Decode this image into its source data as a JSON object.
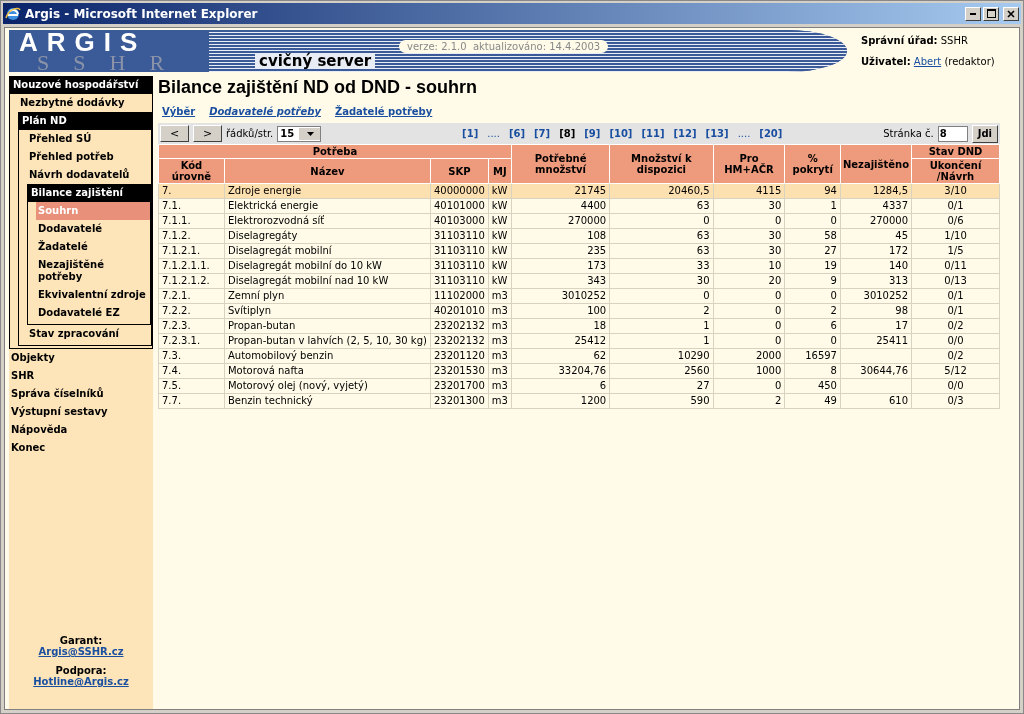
{
  "window": {
    "title": "Argis - Microsoft Internet Explorer"
  },
  "header": {
    "logo": "ARGIS",
    "logo_letters": [
      "S",
      "S",
      "H",
      "R"
    ],
    "server": "cvičný server",
    "version": "verze: 2.1.0  aktualizováno: 14.4.2003",
    "office_label": "Správní úřad:",
    "office": "SSHR",
    "user_label": "Uživatel:",
    "user": "Abert",
    "role": "(redaktor)"
  },
  "sidebar": {
    "items": [
      {
        "label": "Nouzové hospodářství",
        "expanded": true,
        "children": [
          {
            "label": "Nezbytné dodávky"
          },
          {
            "label": "Plán ND",
            "expanded": true,
            "children": [
              {
                "label": "Přehled SÚ"
              },
              {
                "label": "Přehled potřeb"
              },
              {
                "label": "Návrh dodavatelů"
              },
              {
                "label": "Bilance zajištění",
                "expanded": true,
                "children": [
                  {
                    "label": "Souhrn",
                    "selected": true
                  },
                  {
                    "label": "Dodavatelé",
                    "selected": false
                  },
                  {
                    "label": "Žadatelé",
                    "selected": false
                  },
                  {
                    "label": "Nezajištěné potřeby",
                    "selected": false
                  },
                  {
                    "label": "Ekvivalentní zdroje",
                    "selected": false
                  },
                  {
                    "label": "Dodavatelé EZ",
                    "selected": false
                  }
                ]
              },
              {
                "label": "Stav zpracování"
              }
            ]
          }
        ]
      },
      {
        "label": "Objekty"
      },
      {
        "label": "SHR"
      },
      {
        "label": "Správa číselníků"
      },
      {
        "label": "Výstupní sestavy"
      },
      {
        "label": "Nápověda"
      },
      {
        "label": "Konec"
      }
    ],
    "footer": [
      {
        "label": "Garant:",
        "link": "Argis@SSHR.cz"
      },
      {
        "label": "Podpora:",
        "link": "Hotline@Argis.cz"
      }
    ]
  },
  "page": {
    "title": "Bilance zajištění ND od DND - souhrn",
    "links": [
      {
        "label": "Výběr",
        "italic": false
      },
      {
        "label": "Dodavatelé potřeby",
        "italic": true
      },
      {
        "label": "Žadatelé potřeby",
        "italic": false
      }
    ]
  },
  "pager": {
    "prev": "<",
    "next": ">",
    "rows_label": "řádků/str.",
    "rows_per_page": "15",
    "pages": [
      {
        "kind": "page",
        "label": "[1]",
        "selected": false
      },
      {
        "kind": "gap",
        "label": "...."
      },
      {
        "kind": "page",
        "label": "[6]",
        "selected": false
      },
      {
        "kind": "page",
        "label": "[7]",
        "selected": false
      },
      {
        "kind": "page",
        "label": "[8]",
        "selected": true
      },
      {
        "kind": "page",
        "label": "[9]",
        "selected": false
      },
      {
        "kind": "page",
        "label": "[10]",
        "selected": false
      },
      {
        "kind": "page",
        "label": "[11]",
        "selected": false
      },
      {
        "kind": "page",
        "label": "[12]",
        "selected": false
      },
      {
        "kind": "page",
        "label": "[13]",
        "selected": false
      },
      {
        "kind": "gap",
        "label": "...."
      },
      {
        "kind": "page",
        "label": "[20]",
        "selected": false
      }
    ],
    "page_label": "Stránka č.",
    "page_value": "8",
    "go": "Jdi"
  },
  "table": {
    "group_header": "Potřeba",
    "status_header": "Stav DND",
    "columns": [
      {
        "label": "Kód úrovně",
        "kind": "text"
      },
      {
        "label": "Název",
        "kind": "text"
      },
      {
        "label": "SKP",
        "kind": "number"
      },
      {
        "label": "MJ",
        "kind": "text"
      },
      {
        "label": "Potřebné množství",
        "kind": "number"
      },
      {
        "label": "Množství k dispozici",
        "kind": "number"
      },
      {
        "label": "Pro HM+AČR",
        "kind": "number"
      },
      {
        "label": "% pokrytí",
        "kind": "number"
      },
      {
        "label": "Nezajištěno",
        "kind": "number"
      },
      {
        "label": "Ukončení /Návrh",
        "kind": "status"
      }
    ],
    "rows": [
      {
        "selected": true,
        "cells": [
          "7.",
          "Zdroje energie",
          "40000000",
          "kW",
          "21745",
          "20460,5",
          "4115",
          "94",
          "1284,5",
          "3/10"
        ]
      },
      {
        "selected": false,
        "cells": [
          "7.1.",
          "Elektrická energie",
          "40101000",
          "kW",
          "4400",
          "63",
          "30",
          "1",
          "4337",
          "0/1"
        ]
      },
      {
        "selected": false,
        "cells": [
          "7.1.1.",
          "Elektrorozvodná síť",
          "40103000",
          "kW",
          "270000",
          "0",
          "0",
          "0",
          "270000",
          "0/6"
        ]
      },
      {
        "selected": false,
        "cells": [
          "7.1.2.",
          "Diselagregáty",
          "31103110",
          "kW",
          "108",
          "63",
          "30",
          "58",
          "45",
          "1/10"
        ]
      },
      {
        "selected": false,
        "cells": [
          "7.1.2.1.",
          "Diselagregát mobilní",
          "31103110",
          "kW",
          "235",
          "63",
          "30",
          "27",
          "172",
          "1/5"
        ]
      },
      {
        "selected": false,
        "cells": [
          "7.1.2.1.1.",
          "Diselagregát mobilní do 10 kW",
          "31103110",
          "kW",
          "173",
          "33",
          "10",
          "19",
          "140",
          "0/11"
        ]
      },
      {
        "selected": false,
        "cells": [
          "7.1.2.1.2.",
          "Diselagregát mobilní nad 10 kW",
          "31103110",
          "kW",
          "343",
          "30",
          "20",
          "9",
          "313",
          "0/13"
        ]
      },
      {
        "selected": false,
        "cells": [
          "7.2.1.",
          "Zemní plyn",
          "11102000",
          "m3",
          "3010252",
          "0",
          "0",
          "0",
          "3010252",
          "0/1"
        ]
      },
      {
        "selected": false,
        "cells": [
          "7.2.2.",
          "Svítiplyn",
          "40201010",
          "m3",
          "100",
          "2",
          "0",
          "2",
          "98",
          "0/1"
        ]
      },
      {
        "selected": false,
        "cells": [
          "7.2.3.",
          "Propan-butan",
          "23202132",
          "m3",
          "18",
          "1",
          "0",
          "6",
          "17",
          "0/2"
        ]
      },
      {
        "selected": false,
        "cells": [
          "7.2.3.1.",
          "Propan-butan v lahvích (2, 5, 10, 30 kg)",
          "23202132",
          "m3",
          "25412",
          "1",
          "0",
          "0",
          "25411",
          "0/0"
        ]
      },
      {
        "selected": false,
        "cells": [
          "7.3.",
          "Automobilový benzin",
          "23201120",
          "m3",
          "62",
          "10290",
          "2000",
          "16597",
          null,
          "0/2"
        ]
      },
      {
        "selected": false,
        "cells": [
          "7.4.",
          "Motorová nafta",
          "23201530",
          "m3",
          "33204,76",
          "2560",
          "1000",
          "8",
          "30644,76",
          "5/12"
        ]
      },
      {
        "selected": false,
        "cells": [
          "7.5.",
          "Motorový olej (nový, vyjetý)",
          "23201700",
          "m3",
          "6",
          "27",
          "0",
          "450",
          null,
          "0/0"
        ]
      },
      {
        "selected": false,
        "cells": [
          "7.7.",
          "Benzin technický",
          "23201300",
          "m3",
          "1200",
          "590",
          "2",
          "49",
          "610",
          "0/3"
        ]
      }
    ]
  }
}
